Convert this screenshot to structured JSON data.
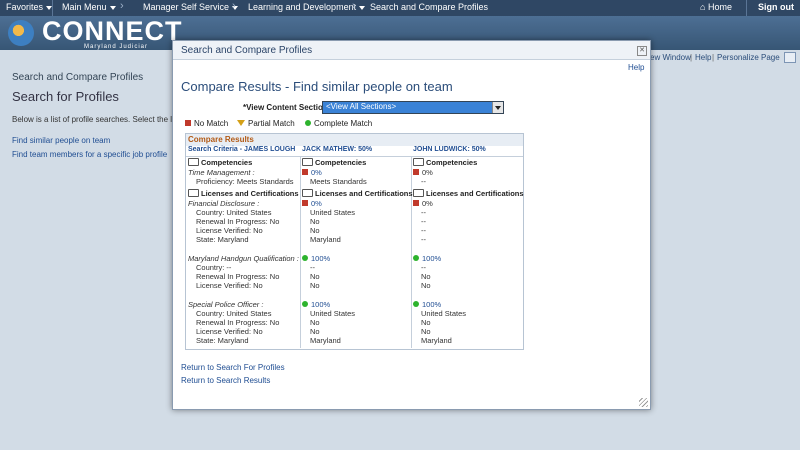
{
  "nav": {
    "favorites": "Favorites",
    "main_menu": "Main Menu",
    "manager_self_service": "Manager Self Service",
    "learning": "Learning and Development",
    "current": "Search and Compare Profiles",
    "home": "Home",
    "sign_out": "Sign out"
  },
  "brand": {
    "title": "CONNECT",
    "subtitle": "Maryland Judiciar"
  },
  "util": {
    "new_window": "ew Window",
    "help": "Help",
    "personalize": "Personalize Page"
  },
  "background": {
    "title": "Search and Compare Profiles",
    "heading": "Search for Profiles",
    "description": "Below is a list of profile searches.  Select the link",
    "link1": "Find similar people on team",
    "link2": "Find team members for a specific job profile"
  },
  "modal": {
    "title": "Search and Compare Profiles",
    "help": "Help",
    "page_title": "Compare Results - Find similar people on team",
    "section_label": "*View Content Section",
    "section_value": "<View All Sections>",
    "legend": {
      "no_match": "No Match",
      "partial": "Partial Match",
      "complete": "Complete Match"
    },
    "table": {
      "title": "Compare Results",
      "col1": "Search Criteria - JAMES LOUGH",
      "col2": "JACK MATHEW: 50%",
      "col3": "JOHN LUDWICK: 50%",
      "competencies": "Competencies",
      "licenses": "Licenses and Certifications",
      "time_management": "Time Management :",
      "proficiency": "Proficiency: Meets Standards",
      "meets_standards": "Meets Standards",
      "financial_disclosure": "Financial Disclosure :",
      "country_us": "Country: United States",
      "renewal_no": "Renewal In Progress: No",
      "verified_no": "License Verified: No",
      "state_md": "State: Maryland",
      "handgun": "Maryland Handgun Qualification :",
      "country_dash": "Country: --",
      "special_police": "Special Police Officer :",
      "united_states": "United States",
      "no": "No",
      "maryland": "Maryland",
      "dash": "--",
      "pct0": "0%",
      "pct100": "100%"
    },
    "return_search": "Return to Search For Profiles",
    "return_results": "Return to Search Results"
  },
  "colors": {
    "accent": "#2f4764",
    "no_match": "#c0392b",
    "partial": "#d4a017",
    "complete": "#2db32d"
  }
}
